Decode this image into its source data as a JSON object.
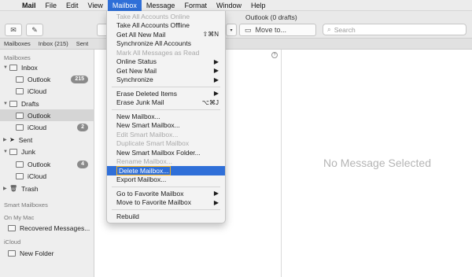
{
  "menubar": {
    "apple": "",
    "items": [
      "Mail",
      "File",
      "Edit",
      "View",
      "Mailbox",
      "Message",
      "Format",
      "Window",
      "Help"
    ],
    "active": "Mailbox"
  },
  "window": {
    "title": "Outlook (0 drafts)",
    "move_to": "Move to...",
    "search_placeholder": "Search"
  },
  "favorites_bar": {
    "mailboxes": "Mailboxes",
    "inbox": "Inbox (215)",
    "sent": "Sent"
  },
  "sidebar": {
    "mailboxes_header": "Mailboxes",
    "inbox": "Inbox",
    "inbox_outlook": "Outlook",
    "inbox_outlook_badge": "215",
    "inbox_icloud": "iCloud",
    "drafts": "Drafts",
    "drafts_outlook": "Outlook",
    "drafts_icloud": "iCloud",
    "drafts_icloud_badge": "2",
    "sent": "Sent",
    "junk": "Junk",
    "junk_outlook": "Outlook",
    "junk_outlook_badge": "4",
    "junk_icloud": "iCloud",
    "trash": "Trash",
    "smart_header": "Smart Mailboxes",
    "onmymac_header": "On My Mac",
    "recovered": "Recovered Messages...",
    "icloud_header": "iCloud",
    "new_folder": "New Folder"
  },
  "preview": {
    "empty_text": "No Message Selected"
  },
  "mailbox_menu": {
    "take_online": "Take All Accounts Online",
    "take_offline": "Take All Accounts Offline",
    "get_all": "Get All New Mail",
    "get_all_shortcut": "⇧⌘N",
    "sync_all": "Synchronize All Accounts",
    "mark_all_read": "Mark All Messages as Read",
    "online_status": "Online Status",
    "get_new_mail": "Get New Mail",
    "synchronize": "Synchronize",
    "erase_deleted": "Erase Deleted Items",
    "erase_junk": "Erase Junk Mail",
    "erase_junk_shortcut": "⌥⌘J",
    "new_mailbox": "New Mailbox...",
    "new_smart": "New Smart Mailbox...",
    "edit_smart": "Edit Smart Mailbox...",
    "duplicate_smart": "Duplicate Smart Mailbox",
    "new_smart_folder": "New Smart Mailbox Folder...",
    "rename": "Rename Mailbox...",
    "delete": "Delete Mailbox...",
    "export": "Export Mailbox...",
    "go_favorite": "Go to Favorite Mailbox",
    "move_favorite": "Move to Favorite Mailbox",
    "rebuild": "Rebuild",
    "submenu_arrow": "▶"
  },
  "colors": {
    "accent": "#2f6fd8",
    "highlight_outline": "#f2b01e"
  }
}
